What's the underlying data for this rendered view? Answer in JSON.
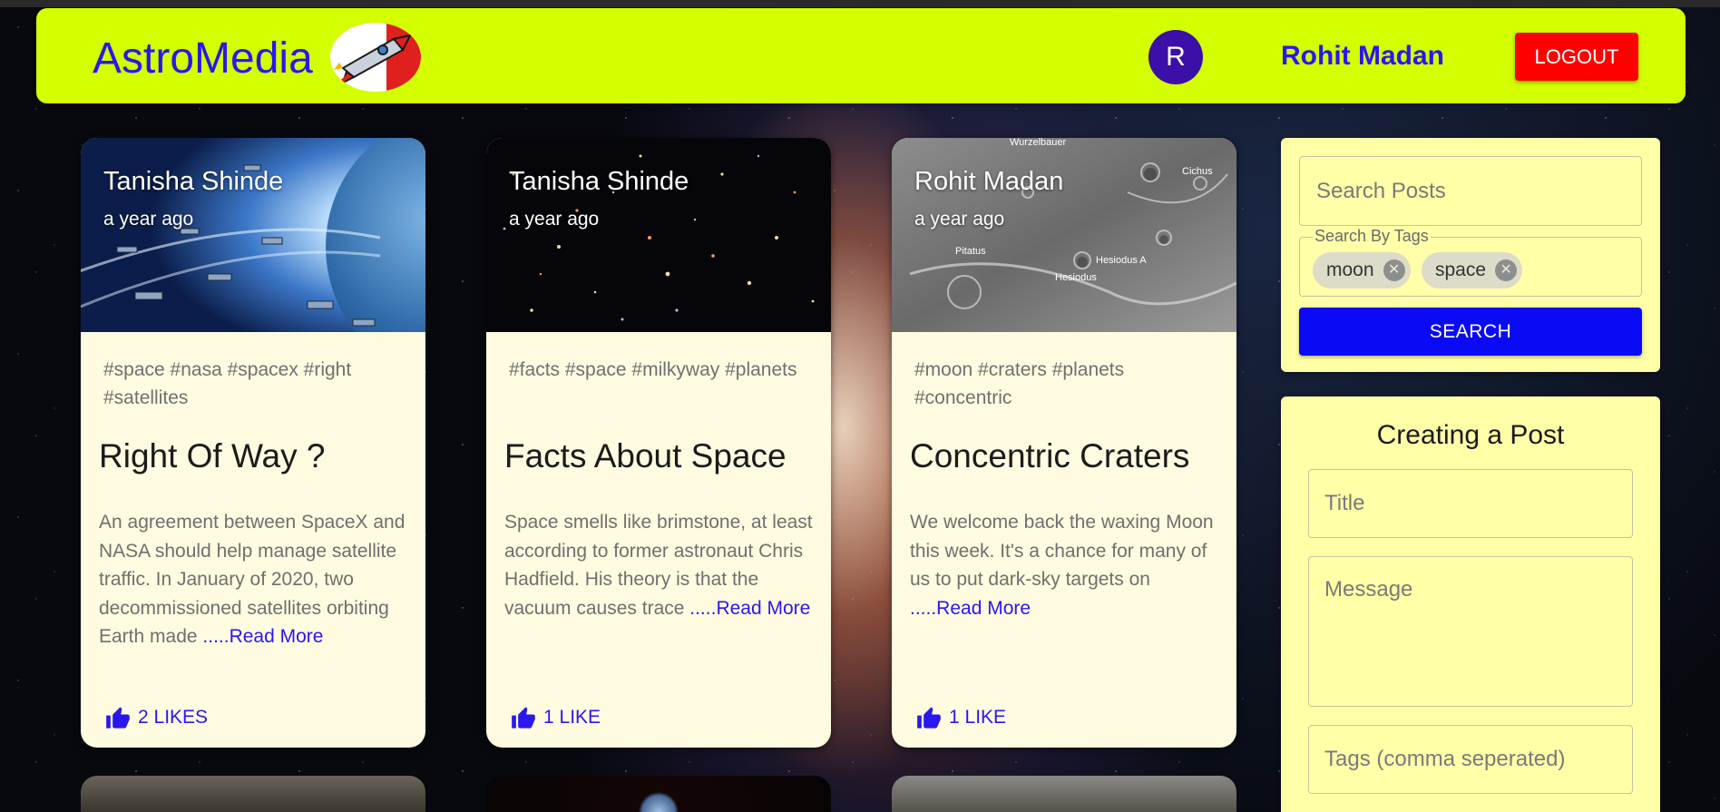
{
  "header": {
    "brand": "AstroMedia",
    "avatar_letter": "R",
    "username": "Rohit Madan",
    "logout_label": "LOGOUT"
  },
  "posts": [
    {
      "author": "Tanisha Shinde",
      "time": "a year ago",
      "tags": "#space #nasa #spacex #right #satellites",
      "title": "Right Of Way ?",
      "message": "An agreement between SpaceX and NASA should help manage satellite traffic. In January of 2020, two decommissioned satellites orbiting Earth made ",
      "read_more": ".....Read More",
      "likes": "2 LIKES"
    },
    {
      "author": "Tanisha Shinde",
      "time": "a year ago",
      "tags": "#facts #space #milkyway #planets",
      "title": "Facts About Space",
      "message": "Space smells like brimstone, at least according to former astronaut Chris Hadfield. His theory is that the vacuum causes trace ",
      "read_more": ".....Read More",
      "likes": "1 LIKE"
    },
    {
      "author": "Rohit Madan",
      "time": "a year ago",
      "tags": "#moon #craters #planets #concentric",
      "title": "Concentric Craters",
      "message": "We welcome back the waxing Moon this week. It's a chance for many of us to put dark-sky targets on ",
      "read_more": ".....Read More",
      "likes": "1 LIKE"
    }
  ],
  "moon_labels": [
    "Wurzelbauer",
    "Cichus",
    "Pitatus",
    "Hesiodus A",
    "Hesiodus"
  ],
  "search": {
    "placeholder": "Search Posts",
    "tags_label": "Search By Tags",
    "tags": [
      "moon",
      "space"
    ],
    "button_label": "SEARCH"
  },
  "create": {
    "heading": "Creating a Post",
    "title_placeholder": "Title",
    "message_placeholder": "Message",
    "tags_placeholder": "Tags (comma seperated)"
  },
  "colors": {
    "header_bg": "#d3ff00",
    "brand": "#2a17ee",
    "logout_bg": "#ff0000",
    "search_button": "#0a0af5",
    "panel_bg": "#ffffa8",
    "card_bg": "#fffbe0"
  }
}
